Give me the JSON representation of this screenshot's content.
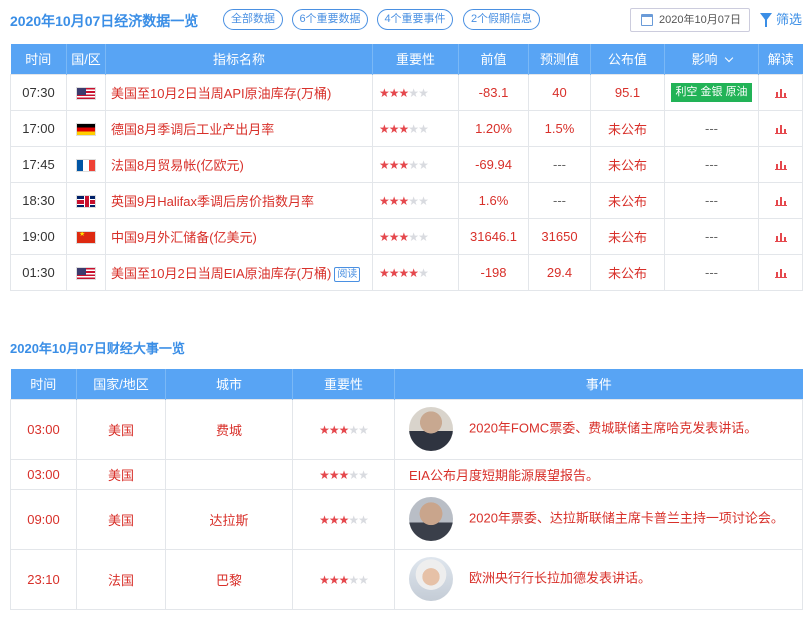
{
  "header": {
    "title": "2020年10月07日经济数据一览",
    "tabs": [
      "全部数据",
      "6个重要数据",
      "4个重要事件",
      "2个假期信息"
    ],
    "date": "2020年10月07日",
    "filter_label": "筛选"
  },
  "econ_table": {
    "columns": [
      "时间",
      "国/区",
      "指标名称",
      "重要性",
      "前值",
      "预测值",
      "公布值",
      "影响",
      "解读"
    ],
    "rows": [
      {
        "time": "07:30",
        "flag": "flag-us",
        "name": "美国至10月2日当周API原油库存(万桶)",
        "stars": 3,
        "prev": "-83.1",
        "forecast": "40",
        "actual": "95.1",
        "impact": "利空 金银 原油",
        "read_tag": ""
      },
      {
        "time": "17:00",
        "flag": "flag-de",
        "name": "德国8月季调后工业产出月率",
        "stars": 3,
        "prev": "1.20%",
        "forecast": "1.5%",
        "actual": "未公布",
        "impact": "---",
        "read_tag": ""
      },
      {
        "time": "17:45",
        "flag": "flag-fr",
        "name": "法国8月贸易帐(亿欧元)",
        "stars": 3,
        "prev": "-69.94",
        "forecast": "---",
        "actual": "未公布",
        "impact": "---",
        "read_tag": ""
      },
      {
        "time": "18:30",
        "flag": "flag-gb",
        "name": "英国9月Halifax季调后房价指数月率",
        "stars": 3,
        "prev": "1.6%",
        "forecast": "---",
        "actual": "未公布",
        "impact": "---",
        "read_tag": ""
      },
      {
        "time": "19:00",
        "flag": "flag-cn",
        "name": "中国9月外汇储备(亿美元)",
        "stars": 3,
        "prev": "31646.1",
        "forecast": "31650",
        "actual": "未公布",
        "impact": "---",
        "read_tag": ""
      },
      {
        "time": "01:30",
        "flag": "flag-us",
        "name": "美国至10月2日当周EIA原油库存(万桶)",
        "stars": 4,
        "prev": "-198",
        "forecast": "29.4",
        "actual": "未公布",
        "impact": "---",
        "read_tag": "阅读"
      }
    ]
  },
  "events_section": {
    "title": "2020年10月07日财经大事一览",
    "columns": [
      "时间",
      "国家/地区",
      "城市",
      "重要性",
      "事件"
    ],
    "rows": [
      {
        "time": "03:00",
        "country": "美国",
        "city": "费城",
        "stars": 3,
        "avatar": "avatar-m",
        "event": "2020年FOMC票委、费城联储主席哈克发表讲话。"
      },
      {
        "time": "03:00",
        "country": "美国",
        "city": "",
        "stars": 3,
        "avatar": "",
        "event": "EIA公布月度短期能源展望报告。"
      },
      {
        "time": "09:00",
        "country": "美国",
        "city": "达拉斯",
        "stars": 3,
        "avatar": "avatar-m2",
        "event": "2020年票委、达拉斯联储主席卡普兰主持一项讨论会。"
      },
      {
        "time": "23:10",
        "country": "法国",
        "city": "巴黎",
        "stars": 3,
        "avatar": "avatar-f",
        "event": "欧洲央行行长拉加德发表讲话。"
      }
    ]
  },
  "colors": {
    "accent": "#58a4f4",
    "title_blue": "#3a8ee6",
    "red_text": "#d8302a",
    "bearish_green": "#22b357"
  }
}
